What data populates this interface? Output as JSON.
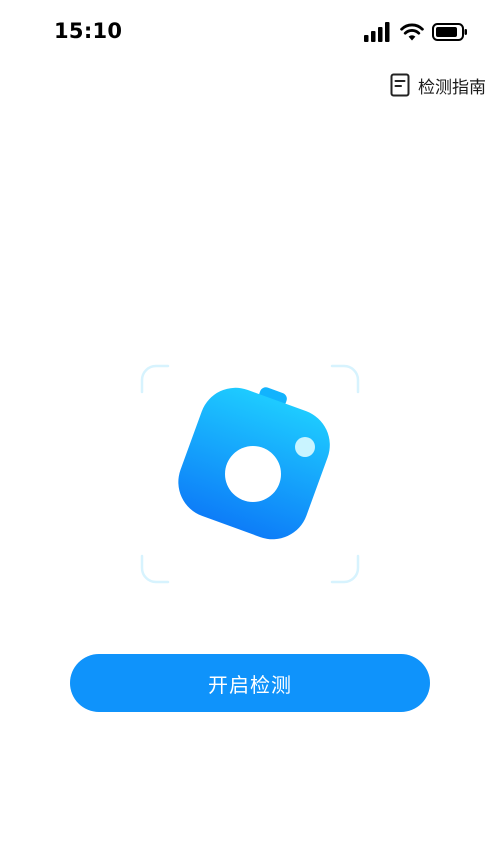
{
  "status_bar": {
    "time": "15:10",
    "icons": [
      "signal-icon",
      "wifi-icon",
      "battery-icon"
    ]
  },
  "header": {
    "guide_label": "检测指南",
    "guide_icon": "book-icon"
  },
  "main": {
    "illustration_icon": "camera-icon",
    "start_label": "开启检测"
  },
  "colors": {
    "primary": "#0f93fb",
    "camera_gradient_top": "#1ecbff",
    "camera_gradient_bottom": "#0d7df8",
    "frame_corner": "#d7f3fe"
  }
}
